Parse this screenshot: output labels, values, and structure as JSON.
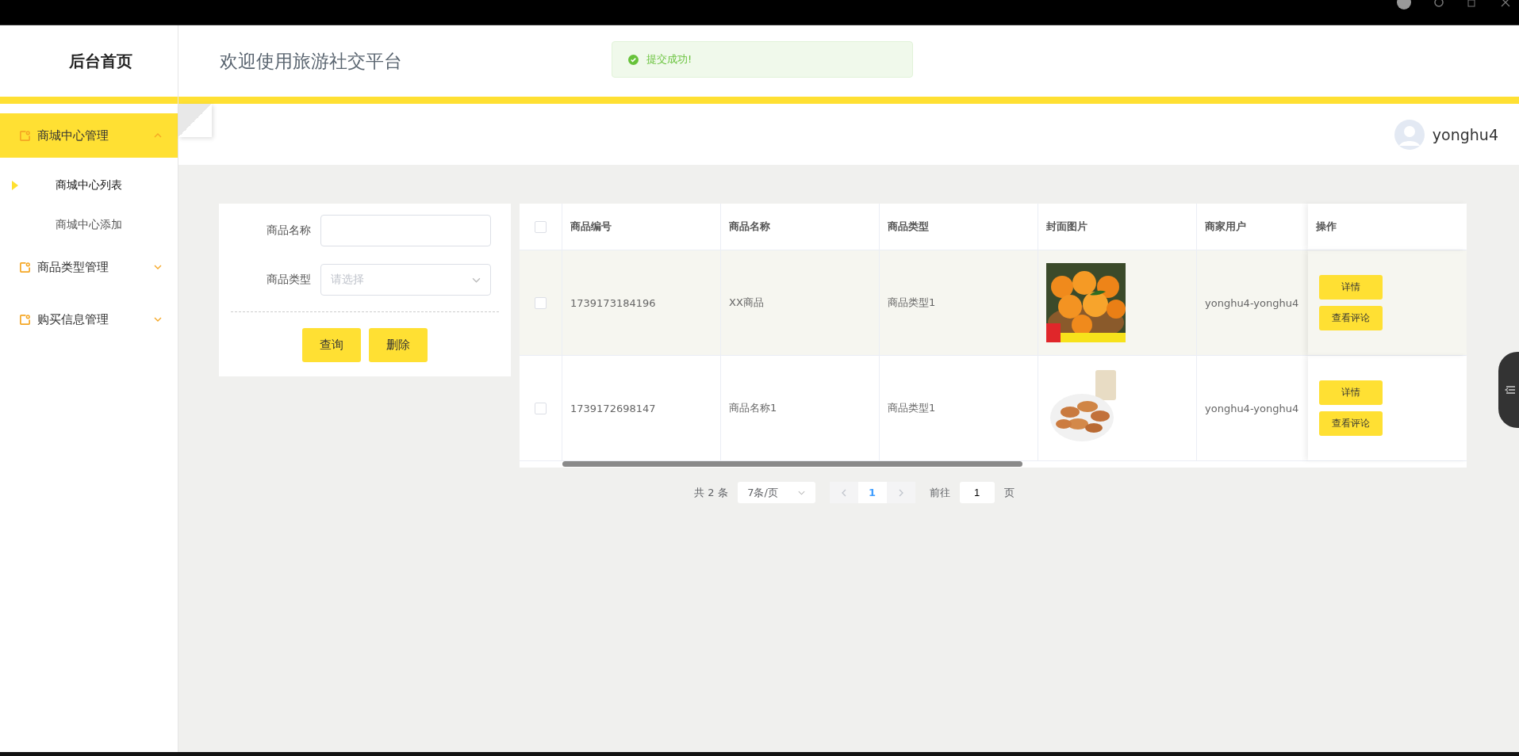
{
  "header": {
    "brand": "后台首页",
    "title": "欢迎使用旅游社交平台"
  },
  "toast": {
    "message": "提交成功!"
  },
  "user": {
    "name": "yonghu4"
  },
  "sidebar": {
    "items": [
      {
        "label": "商城中心管理",
        "expanded": true,
        "selected": true,
        "children": [
          {
            "label": "商城中心列表",
            "selected": true
          },
          {
            "label": "商城中心添加",
            "selected": false
          }
        ]
      },
      {
        "label": "商品类型管理",
        "expanded": false,
        "selected": false
      },
      {
        "label": "购买信息管理",
        "expanded": false,
        "selected": false
      }
    ]
  },
  "search": {
    "fields": [
      {
        "label": "商品名称",
        "kind": "input"
      },
      {
        "label": "商品类型",
        "kind": "select",
        "placeholder": "请选择"
      }
    ],
    "buttons": [
      "查询",
      "删除"
    ]
  },
  "table": {
    "all_checked": false,
    "columns": [
      "商品编号",
      "商品名称",
      "商品类型",
      "封面图片",
      "商家用户",
      "操作"
    ],
    "rows": [
      {
        "checked": false,
        "hovered": true,
        "cells": [
          "1739173184196",
          "XX商品",
          "商品类型1"
        ],
        "cover": {
          "kind": "picture"
        },
        "user": "yonghu4-yonghu4",
        "actions": [
          "详情",
          "查看评论"
        ]
      },
      {
        "checked": false,
        "hovered": false,
        "cells": [
          "1739172698147",
          "商品名称1",
          "商品类型1"
        ],
        "cover": {
          "kind": "picture"
        },
        "user": "yonghu4-yonghu4",
        "actions": [
          "详情",
          "查看评论"
        ]
      }
    ]
  },
  "pagination": {
    "total": "共 2 条",
    "page_size": "7条/页",
    "pages": [
      {
        "label": "1",
        "selected": true
      }
    ],
    "goto_label": "前往",
    "goto_value": "1",
    "goto_suffix": "页"
  }
}
